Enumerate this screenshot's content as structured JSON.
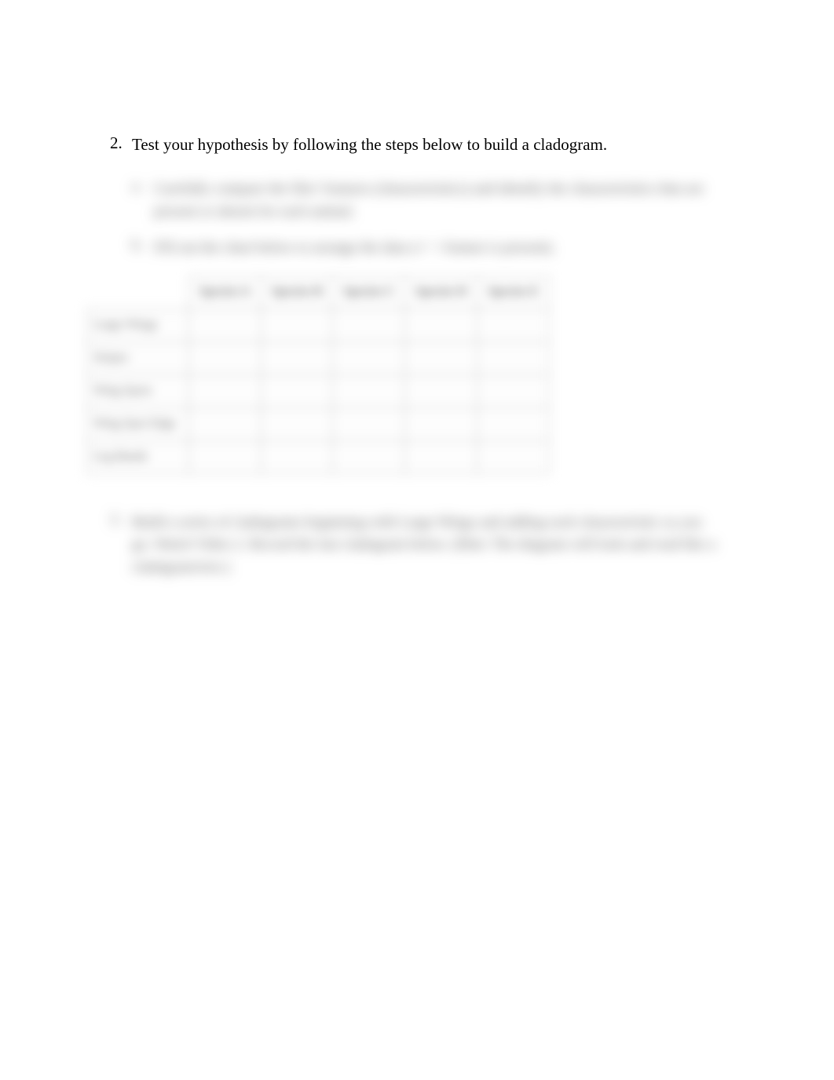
{
  "main": {
    "number": "2.",
    "text": "Test your hypothesis by following the steps below to build a cladogram."
  },
  "sub": {
    "a": {
      "letter": "a.",
      "text": "Carefully compare the files' features (characteristics) and identify the characteristics that are present or absent for each animal."
    },
    "b": {
      "letter": "b.",
      "text": "Fill out the chart below to arrange the data (✓ = feature is present)."
    }
  },
  "table": {
    "headers": [
      "Species A",
      "Species B",
      "Species C",
      "Species D",
      "Species E"
    ],
    "rows": [
      {
        "label": "Large Wings",
        "cells": [
          "",
          "",
          "",
          "",
          ""
        ]
      },
      {
        "label": "Stripes",
        "cells": [
          "",
          "",
          "",
          "",
          ""
        ]
      },
      {
        "label": "Wing Spots",
        "cells": [
          "",
          "",
          "",
          "",
          ""
        ]
      },
      {
        "label": "Wing Spot Edge",
        "cells": [
          "",
          "",
          "",
          "",
          ""
        ]
      },
      {
        "label": "Leg Bands",
        "cells": [
          "",
          "",
          "",
          "",
          ""
        ]
      }
    ]
  },
  "item3": {
    "number": "3.",
    "text": "Build a series of cladograms beginning with Large Wings and adding each characteristic as you go. Watch Video 2. Record the last cladogram below. (Hint: The diagram will look and read like a cladogram/tree.)"
  }
}
